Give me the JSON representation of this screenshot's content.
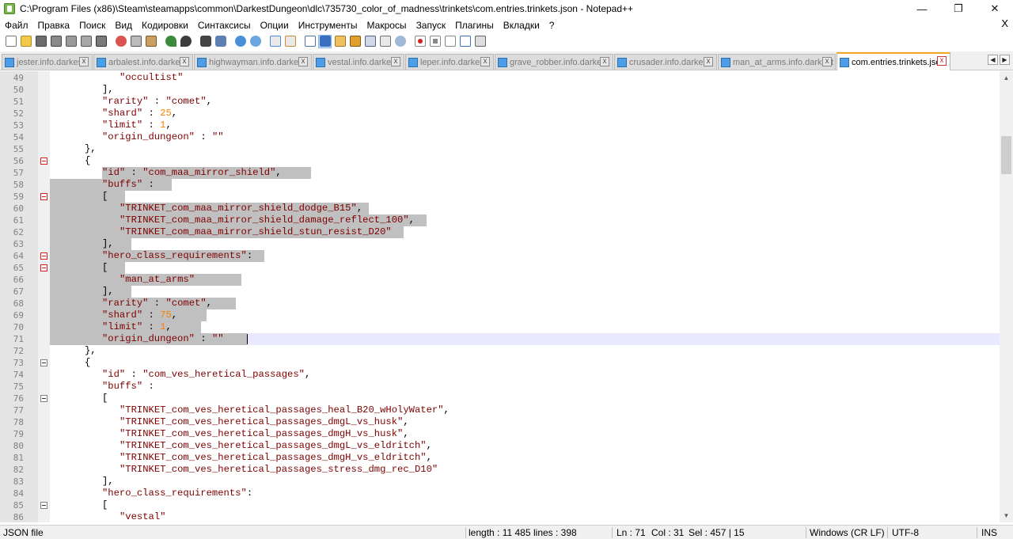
{
  "window": {
    "title": "C:\\Program Files (x86)\\Steam\\steamapps\\common\\DarkestDungeon\\dlc\\735730_color_of_madness\\trinkets\\com.entries.trinkets.json - Notepad++",
    "minimize": "—",
    "maximize": "❐",
    "close": "✕"
  },
  "menu": {
    "items": [
      "Файл",
      "Правка",
      "Поиск",
      "Вид",
      "Кодировки",
      "Синтаксисы",
      "Опции",
      "Инструменты",
      "Макросы",
      "Запуск",
      "Плагины",
      "Вкладки",
      "?"
    ],
    "close": "X"
  },
  "tabs": [
    {
      "label": "jester.info.darkest",
      "active": false
    },
    {
      "label": "arbalest.info.darkest",
      "active": false
    },
    {
      "label": "highwayman.info.darkest",
      "active": false
    },
    {
      "label": "vestal.info.darkest",
      "active": false
    },
    {
      "label": "leper.info.darkest",
      "active": false
    },
    {
      "label": "grave_robber.info.darkest",
      "active": false
    },
    {
      "label": "crusader.info.darkest",
      "active": false
    },
    {
      "label": "man_at_arms.info.darkest",
      "active": false
    },
    {
      "label": "com.entries.trinkets.json",
      "active": true
    }
  ],
  "tab_close": "x",
  "tab_arrows": [
    "◀",
    "▶"
  ],
  "colors": {
    "string": "#7f0000",
    "number": "#ff8000",
    "selection": "#c0c0c0",
    "current_line": "#e8e8ff"
  },
  "editor": {
    "lines": [
      {
        "n": "49",
        "indent": 4,
        "tokens": [
          [
            "s",
            "\"occultist\""
          ]
        ]
      },
      {
        "n": "50",
        "indent": 3,
        "tokens": [
          [
            "p",
            "],"
          ]
        ]
      },
      {
        "n": "51",
        "indent": 3,
        "tokens": [
          [
            "s",
            "\"rarity\""
          ],
          [
            "p",
            " : "
          ],
          [
            "s",
            "\"comet\""
          ],
          [
            "p",
            ","
          ]
        ]
      },
      {
        "n": "52",
        "indent": 3,
        "tokens": [
          [
            "s",
            "\"shard\""
          ],
          [
            "p",
            " : "
          ],
          [
            "n",
            "25"
          ],
          [
            "p",
            ","
          ]
        ]
      },
      {
        "n": "53",
        "indent": 3,
        "tokens": [
          [
            "s",
            "\"limit\""
          ],
          [
            "p",
            " : "
          ],
          [
            "n",
            "1"
          ],
          [
            "p",
            ","
          ]
        ]
      },
      {
        "n": "54",
        "indent": 3,
        "tokens": [
          [
            "s",
            "\"origin_dungeon\""
          ],
          [
            "p",
            " : "
          ],
          [
            "s",
            "\"\""
          ]
        ]
      },
      {
        "n": "55",
        "indent": 2,
        "tokens": [
          [
            "p",
            "},"
          ]
        ]
      },
      {
        "n": "56",
        "indent": 2,
        "fold": "red",
        "tokens": [
          [
            "p",
            "{"
          ]
        ]
      },
      {
        "n": "57",
        "indent": 3,
        "sel": [
          3,
          36
        ],
        "tokens": [
          [
            "s",
            "\"id\""
          ],
          [
            "p",
            " : "
          ],
          [
            "s",
            "\"com_maa_mirror_shield\""
          ],
          [
            "p",
            ","
          ]
        ]
      },
      {
        "n": "58",
        "indent": 3,
        "sel": [
          0,
          12
        ],
        "tokens": [
          [
            "s",
            "\"buffs\""
          ],
          [
            "p",
            " : "
          ]
        ]
      },
      {
        "n": "59",
        "indent": 3,
        "sel": [
          0,
          4
        ],
        "fold": "red",
        "tokens": [
          [
            "p",
            "["
          ]
        ]
      },
      {
        "n": "60",
        "indent": 4,
        "sel": [
          0,
          43
        ],
        "tokens": [
          [
            "s",
            "\"TRINKET_com_maa_mirror_shield_dodge_B15\""
          ],
          [
            "p",
            ","
          ]
        ]
      },
      {
        "n": "61",
        "indent": 4,
        "sel": [
          0,
          53
        ],
        "tokens": [
          [
            "s",
            "\"TRINKET_com_maa_mirror_shield_damage_reflect_100\""
          ],
          [
            "p",
            ","
          ]
        ]
      },
      {
        "n": "62",
        "indent": 4,
        "sel": [
          0,
          49
        ],
        "tokens": [
          [
            "s",
            "\"TRINKET_com_maa_mirror_shield_stun_resist_D20\""
          ]
        ]
      },
      {
        "n": "63",
        "indent": 3,
        "sel": [
          0,
          5
        ],
        "tokens": [
          [
            "p",
            "],"
          ]
        ]
      },
      {
        "n": "64",
        "indent": 3,
        "sel": [
          0,
          28
        ],
        "fold": "red",
        "tokens": [
          [
            "s",
            "\"hero_class_requirements\""
          ],
          [
            "p",
            ":"
          ]
        ]
      },
      {
        "n": "65",
        "indent": 3,
        "sel": [
          0,
          4
        ],
        "fold": "red",
        "tokens": [
          [
            "p",
            "["
          ]
        ]
      },
      {
        "n": "66",
        "indent": 4,
        "sel": [
          0,
          21
        ],
        "tokens": [
          [
            "s",
            "\"man_at_arms\""
          ]
        ]
      },
      {
        "n": "67",
        "indent": 3,
        "sel": [
          0,
          5
        ],
        "tokens": [
          [
            "p",
            "],"
          ]
        ]
      },
      {
        "n": "68",
        "indent": 3,
        "sel": [
          0,
          23
        ],
        "tokens": [
          [
            "s",
            "\"rarity\""
          ],
          [
            "p",
            " : "
          ],
          [
            "s",
            "\"comet\""
          ],
          [
            "p",
            ","
          ]
        ]
      },
      {
        "n": "69",
        "indent": 3,
        "sel": [
          0,
          18
        ],
        "tokens": [
          [
            "s",
            "\"shard\""
          ],
          [
            "p",
            " : "
          ],
          [
            "n",
            "75"
          ],
          [
            "p",
            ","
          ]
        ]
      },
      {
        "n": "70",
        "indent": 3,
        "sel": [
          0,
          17
        ],
        "tokens": [
          [
            "s",
            "\"limit\""
          ],
          [
            "p",
            " : "
          ],
          [
            "n",
            "1"
          ],
          [
            "p",
            ","
          ]
        ]
      },
      {
        "n": "71",
        "indent": 3,
        "sel": [
          0,
          25
        ],
        "current": true,
        "caret": 25,
        "tokens": [
          [
            "s",
            "\"origin_dungeon\""
          ],
          [
            "p",
            " : "
          ],
          [
            "s",
            "\"\""
          ]
        ]
      },
      {
        "n": "72",
        "indent": 2,
        "tokens": [
          [
            "p",
            "},"
          ]
        ]
      },
      {
        "n": "73",
        "indent": 2,
        "fold": "grey",
        "tokens": [
          [
            "p",
            "{"
          ]
        ]
      },
      {
        "n": "74",
        "indent": 3,
        "tokens": [
          [
            "s",
            "\"id\""
          ],
          [
            "p",
            " : "
          ],
          [
            "s",
            "\"com_ves_heretical_passages\""
          ],
          [
            "p",
            ","
          ]
        ]
      },
      {
        "n": "75",
        "indent": 3,
        "tokens": [
          [
            "s",
            "\"buffs\""
          ],
          [
            "p",
            " :"
          ]
        ]
      },
      {
        "n": "76",
        "indent": 3,
        "fold": "grey",
        "tokens": [
          [
            "p",
            "["
          ]
        ]
      },
      {
        "n": "77",
        "indent": 4,
        "tokens": [
          [
            "s",
            "\"TRINKET_com_ves_heretical_passages_heal_B20_wHolyWater\""
          ],
          [
            "p",
            ","
          ]
        ]
      },
      {
        "n": "78",
        "indent": 4,
        "tokens": [
          [
            "s",
            "\"TRINKET_com_ves_heretical_passages_dmgL_vs_husk\""
          ],
          [
            "p",
            ","
          ]
        ]
      },
      {
        "n": "79",
        "indent": 4,
        "tokens": [
          [
            "s",
            "\"TRINKET_com_ves_heretical_passages_dmgH_vs_husk\""
          ],
          [
            "p",
            ","
          ]
        ]
      },
      {
        "n": "80",
        "indent": 4,
        "tokens": [
          [
            "s",
            "\"TRINKET_com_ves_heretical_passages_dmgL_vs_eldritch\""
          ],
          [
            "p",
            ","
          ]
        ]
      },
      {
        "n": "81",
        "indent": 4,
        "tokens": [
          [
            "s",
            "\"TRINKET_com_ves_heretical_passages_dmgH_vs_eldritch\""
          ],
          [
            "p",
            ","
          ]
        ]
      },
      {
        "n": "82",
        "indent": 4,
        "tokens": [
          [
            "s",
            "\"TRINKET_com_ves_heretical_passages_stress_dmg_rec_D10\""
          ]
        ]
      },
      {
        "n": "83",
        "indent": 3,
        "tokens": [
          [
            "p",
            "],"
          ]
        ]
      },
      {
        "n": "84",
        "indent": 3,
        "tokens": [
          [
            "s",
            "\"hero_class_requirements\""
          ],
          [
            "p",
            ":"
          ]
        ]
      },
      {
        "n": "85",
        "indent": 3,
        "fold": "grey",
        "tokens": [
          [
            "p",
            "["
          ]
        ]
      },
      {
        "n": "86",
        "indent": 4,
        "tokens": [
          [
            "s",
            "\"vestal\""
          ]
        ]
      }
    ]
  },
  "status": {
    "file_type": "JSON file",
    "length": "length : 11 485",
    "lines": "lines : 398",
    "ln": "Ln : 71",
    "col": "Col : 31",
    "sel": "Sel : 457 | 15",
    "eol": "Windows (CR LF)",
    "encoding": "UTF-8",
    "mode": "INS"
  },
  "scrollbar": {
    "up": "▲",
    "down": "▼"
  }
}
